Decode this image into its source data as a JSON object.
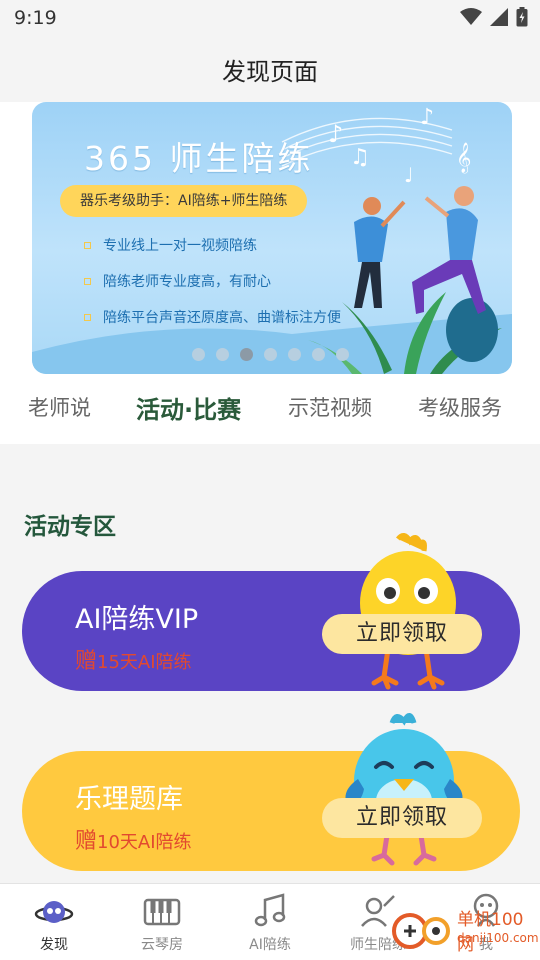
{
  "status_bar": {
    "time": "9:19"
  },
  "header": {
    "title": "发现页面"
  },
  "banner": {
    "title": "365 师生陪练",
    "pill": "器乐考级助手：AI陪练+师生陪练",
    "features": [
      "专业线上一对一视频陪练",
      "陪练老师专业度高，有耐心",
      "陪练平台声音还原度高、曲谱标注方便"
    ],
    "dots_count": 7,
    "active_dot": 3
  },
  "tabs": [
    {
      "label": "老师说"
    },
    {
      "label": "活动·比赛"
    },
    {
      "label": "示范视频"
    },
    {
      "label": "考级服务"
    }
  ],
  "active_tab": 1,
  "section": {
    "title": "活动专区"
  },
  "promos": [
    {
      "title": "AI陪练VIP",
      "sub_prefix": "赠",
      "sub_text": "15天AI陪练",
      "button": "立即领取",
      "color": "#5a44c4"
    },
    {
      "title": "乐理题库",
      "sub_prefix": "赠",
      "sub_text": "10天AI陪练",
      "button": "立即领取",
      "color": "#ffc93f"
    }
  ],
  "bottom_nav": [
    {
      "label": "发现",
      "icon": "planet-icon",
      "active": true
    },
    {
      "label": "云琴房",
      "icon": "piano-icon",
      "active": false
    },
    {
      "label": "AI陪练",
      "icon": "music-note-icon",
      "active": false
    },
    {
      "label": "师生陪练",
      "icon": "teacher-student-icon",
      "active": false
    },
    {
      "label": "我",
      "icon": "profile-icon",
      "active": false
    }
  ],
  "watermark": {
    "text": "单机100网",
    "sub": "danji100.com"
  },
  "colors": {
    "accent_green": "#24573c",
    "vip_purple": "#5a44c4",
    "theory_yellow": "#ffc93f",
    "gift_red": "#e2492f"
  }
}
